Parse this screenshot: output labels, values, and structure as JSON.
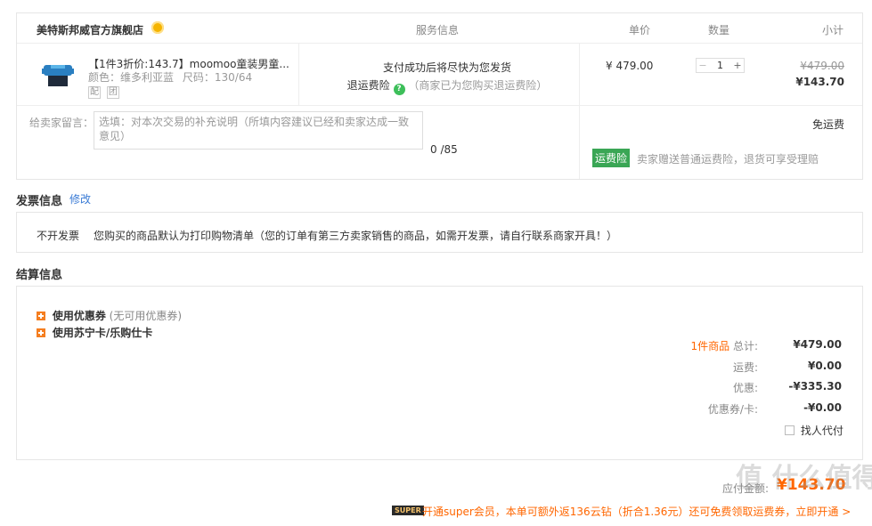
{
  "header": {
    "store_name": "美特斯邦威官方旗舰店",
    "col_service": "服务信息",
    "col_price": "单价",
    "col_qty": "数量",
    "col_subtotal": "小计"
  },
  "item": {
    "title": "【1件3折价:143.7】moomoo童装男童...",
    "color_label": "颜色：",
    "color": "维多利亚蓝",
    "size_label": "尺码：",
    "size": "130/64",
    "badge1": "配",
    "badge2": "团",
    "service_line1": "支付成功后将尽快为您发货",
    "service_insurance": "退运费险",
    "service_note": "（商家已为您购买退运费险）",
    "unit_price": "¥ 479.00",
    "qty_minus": "−",
    "qty_value": "1",
    "qty_plus": "+",
    "subtotal_original": "¥479.00",
    "subtotal_final": "¥143.70"
  },
  "message": {
    "label": "给卖家留言：",
    "placeholder": "选填：对本次交易的补充说明（所填内容建议已经和卖家达成一致意见）",
    "counter": "0 /85",
    "shipping": "免运费",
    "insurance_tag": "运费险",
    "insurance_text": "卖家赠送普通运费险，退货可享受理赔"
  },
  "invoice": {
    "title": "发票信息",
    "edit_link": "修改",
    "type": "不开发票",
    "text": "您购买的商品默认为打印购物清单（您的订单有第三方卖家销售的商品，如需开发票，请自行联系商家开具！）"
  },
  "settlement": {
    "title": "结算信息",
    "coupon_label": "使用优惠券",
    "coupon_note": "(无可用优惠券)",
    "card_label": "使用苏宁卡/乐购仕卡",
    "rows": [
      {
        "label_prefix": "1件商品",
        "label": " 总计:",
        "value": "¥479.00"
      },
      {
        "label_prefix": "",
        "label": "运费:",
        "value": "¥0.00"
      },
      {
        "label_prefix": "",
        "label": "优惠:",
        "value": "-¥335.30"
      },
      {
        "label_prefix": "",
        "label": "优惠券/卡:",
        "value": "-¥0.00"
      }
    ],
    "proxy_pay": "找人代付"
  },
  "footer": {
    "payable_label": "应付金额:",
    "payable_value": "¥143.70",
    "super_badge": "SUPER",
    "super_text": "开通super会员，本单可额外返136云钻（折合1.36元）还可免费领取运费券，立即开通 >",
    "watermark": "值 什么值得买"
  }
}
